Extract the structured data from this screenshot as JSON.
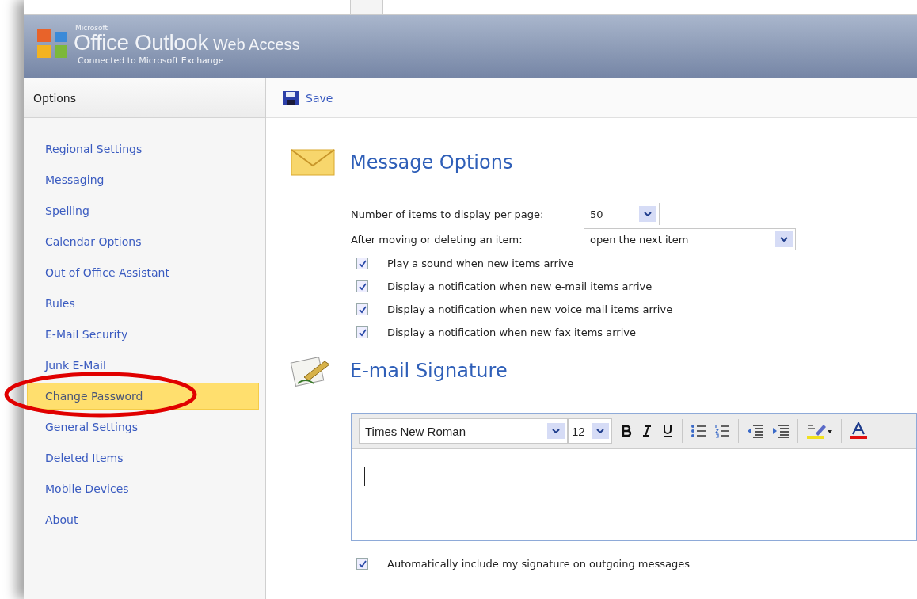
{
  "header": {
    "brand_small": "Microsoft",
    "brand_main": "Office Outlook",
    "brand_suffix": "Web Access",
    "subtitle": "Connected to Microsoft Exchange"
  },
  "sidebar": {
    "title": "Options",
    "items": [
      {
        "label": "Regional Settings",
        "selected": false
      },
      {
        "label": "Messaging",
        "selected": false
      },
      {
        "label": "Spelling",
        "selected": false
      },
      {
        "label": "Calendar Options",
        "selected": false
      },
      {
        "label": "Out of Office Assistant",
        "selected": false
      },
      {
        "label": "Rules",
        "selected": false
      },
      {
        "label": "E-Mail Security",
        "selected": false
      },
      {
        "label": "Junk E-Mail",
        "selected": false
      },
      {
        "label": "Change Password",
        "selected": true
      },
      {
        "label": "General Settings",
        "selected": false
      },
      {
        "label": "Deleted Items",
        "selected": false
      },
      {
        "label": "Mobile Devices",
        "selected": false
      },
      {
        "label": "About",
        "selected": false
      }
    ]
  },
  "toolbar": {
    "save": "Save"
  },
  "message_options": {
    "title": "Message Options",
    "fields": [
      {
        "label": "Number of items to display per page:",
        "value": "50",
        "kind": "short"
      },
      {
        "label": "After moving or deleting an item:",
        "value": "open the next item",
        "kind": "wide"
      }
    ],
    "checkboxes": [
      {
        "label": "Play a sound when new items arrive",
        "checked": true
      },
      {
        "label": "Display a notification when new e-mail items arrive",
        "checked": true
      },
      {
        "label": "Display a notification when new voice mail items arrive",
        "checked": true
      },
      {
        "label": "Display a notification when new fax items arrive",
        "checked": true
      }
    ]
  },
  "signature": {
    "title": "E-mail Signature",
    "font": "Times New Roman",
    "size": "12",
    "auto_include": {
      "label": "Automatically include my signature on outgoing messages",
      "checked": true
    }
  }
}
